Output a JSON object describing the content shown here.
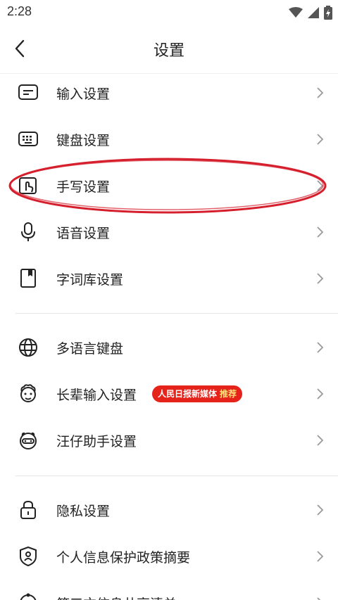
{
  "status_bar": {
    "time": "2:28"
  },
  "header": {
    "title": "设置"
  },
  "items": [
    {
      "label": "输入设置",
      "icon": "keyboard-input-icon"
    },
    {
      "label": "键盘设置",
      "icon": "keyboard-icon"
    },
    {
      "label": "手写设置",
      "icon": "handwriting-icon"
    },
    {
      "label": "语音设置",
      "icon": "microphone-icon"
    },
    {
      "label": "字词库设置",
      "icon": "dictionary-icon"
    },
    {
      "label": "多语言键盘",
      "icon": "globe-icon"
    },
    {
      "label": "长辈输入设置",
      "icon": "elder-face-icon",
      "badge": {
        "text": "人民日报新媒体",
        "sub": "推荐"
      }
    },
    {
      "label": "汪仔助手设置",
      "icon": "mascot-icon"
    },
    {
      "label": "隐私设置",
      "icon": "lock-icon"
    },
    {
      "label": "个人信息保护政策摘要",
      "icon": "shield-user-icon"
    },
    {
      "label": "第三方信息共享清单",
      "icon": "share-list-icon"
    }
  ],
  "colors": {
    "badge": "#e5231b",
    "highlight": "#d61f2c",
    "text": "#222222"
  }
}
